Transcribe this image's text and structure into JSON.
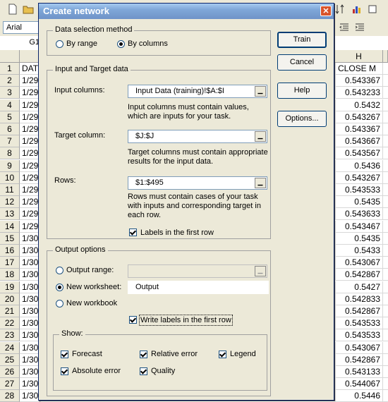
{
  "spreadsheet": {
    "font_name": "Arial",
    "name_box": "G1",
    "column_h_header": "H",
    "row_numbers": [
      "1",
      "2",
      "3",
      "4",
      "5",
      "6",
      "7",
      "8",
      "9",
      "10",
      "11",
      "12",
      "13",
      "14",
      "15",
      "16",
      "17",
      "18",
      "19",
      "20",
      "21",
      "22",
      "23",
      "24",
      "25",
      "26",
      "27",
      "28"
    ],
    "column_a": [
      "DAT",
      "1/29",
      "1/29",
      "1/29",
      "1/29",
      "1/29",
      "1/29",
      "1/29",
      "1/29",
      "1/29",
      "1/29",
      "1/29",
      "1/29",
      "1/29",
      "1/30",
      "1/30",
      "1/30",
      "1/30",
      "1/30",
      "1/30",
      "1/30",
      "1/30",
      "1/30",
      "1/30",
      "1/30",
      "1/30",
      "1/30",
      "1/30"
    ],
    "column_h": [
      "CLOSE M",
      "0.543367",
      "0.543233",
      "0.5432",
      "0.543267",
      "0.543367",
      "0.543667",
      "0.543567",
      "0.5436",
      "0.543267",
      "0.543533",
      "0.5435",
      "0.543633",
      "0.543467",
      "0.5435",
      "0.5433",
      "0.543067",
      "0.542867",
      "0.5427",
      "0.542833",
      "0.542867",
      "0.543533",
      "0.543533",
      "0.543067",
      "0.542867",
      "0.543133",
      "0.544067",
      "0.5446"
    ]
  },
  "dialog": {
    "title": "Create network",
    "buttons": {
      "train": "Train",
      "cancel": "Cancel",
      "help": "Help",
      "options": "Options..."
    },
    "data_selection": {
      "legend": "Data selection method",
      "by_range": "By range",
      "by_columns": "By columns",
      "selected": "by_columns"
    },
    "input_target": {
      "legend": "Input and Target data",
      "input_columns_label": "Input columns:",
      "input_columns_value": "Input Data (training)!$A:$I",
      "input_columns_help": "Input columns must contain values, which are inputs for your task.",
      "target_column_label": "Target column:",
      "target_column_value": "$J:$J",
      "target_column_help": "Target columns must contain appropriate results for the input data.",
      "rows_label": "Rows:",
      "rows_value": "$1:$495",
      "rows_help": "Rows must contain cases of your task with inputs and corresponding target in each row.",
      "labels_first_row": "Labels in the first row",
      "labels_first_row_checked": true
    },
    "output_options": {
      "legend": "Output options",
      "output_range": "Output range:",
      "output_range_value": "",
      "new_worksheet": "New worksheet:",
      "new_worksheet_value": "Output",
      "new_workbook": "New workbook",
      "selected": "new_worksheet",
      "write_labels": "Write labels in the first row",
      "write_labels_checked": true
    },
    "show": {
      "legend": "Show:",
      "forecast": "Forecast",
      "relative_error": "Relative error",
      "legend_option": "Legend",
      "absolute_error": "Absolute error",
      "quality": "Quality",
      "all_checked": true
    }
  }
}
